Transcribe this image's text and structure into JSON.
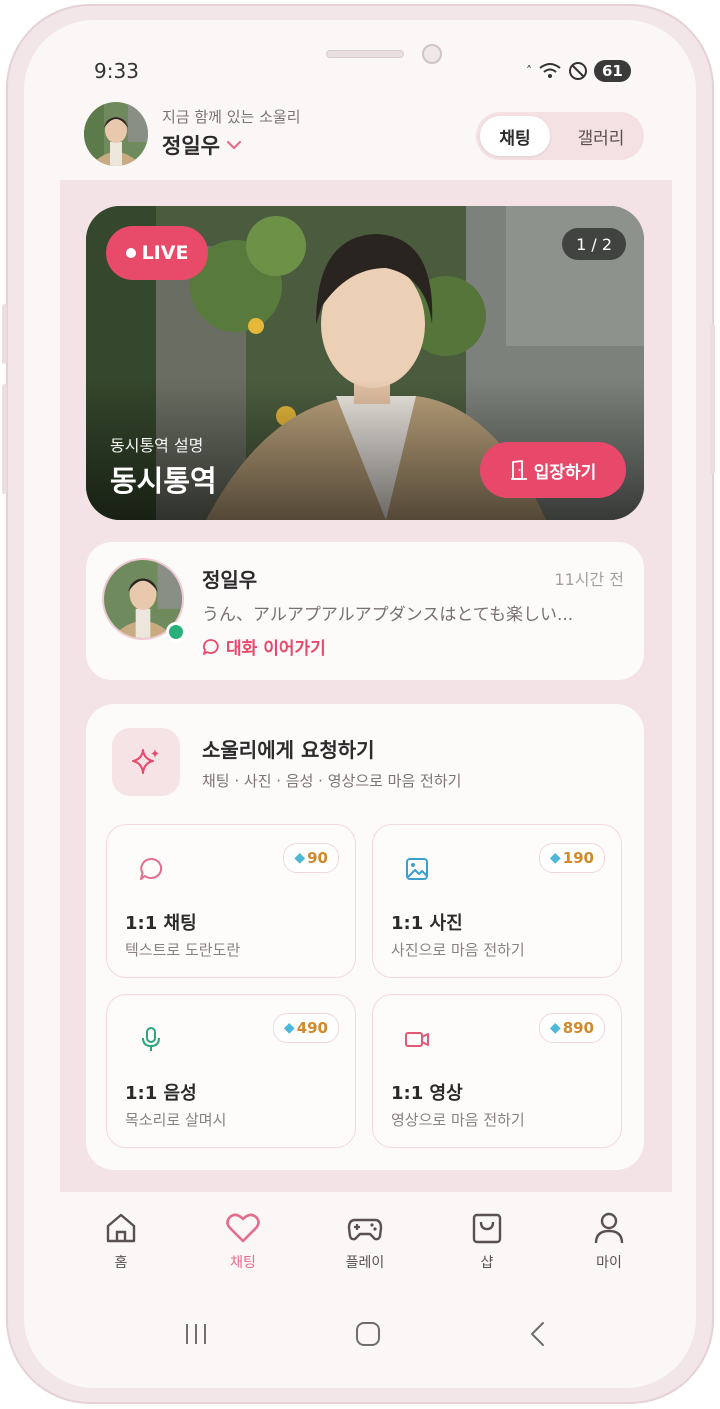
{
  "status_bar": {
    "time": "9:33",
    "battery": "61"
  },
  "header": {
    "subtitle": "지금 함께 있는 소울리",
    "name": "정일우",
    "toggle": {
      "active": "채팅",
      "inactive": "갤러리"
    }
  },
  "live": {
    "badge": "LIVE",
    "counter": "1 / 2",
    "desc": "동시통역 설명",
    "title": "동시통역",
    "enter_label": "입장하기"
  },
  "recent_chat": {
    "name": "정일우",
    "time": "11시간 전",
    "message": "うん、アルアプアルアプダンスはとても楽しい...",
    "cta": "대화 이어가기"
  },
  "request": {
    "title": "소울리에게 요청하기",
    "subtitle": "채팅 · 사진 · 음성 · 영상으로 마음 전하기",
    "items": [
      {
        "name": "1:1 채팅",
        "desc": "텍스트로 도란도란",
        "price": "90",
        "icon": "chat-bubble-icon"
      },
      {
        "name": "1:1 사진",
        "desc": "사진으로 마음 전하기",
        "price": "190",
        "icon": "image-icon"
      },
      {
        "name": "1:1 음성",
        "desc": "목소리로 살며시",
        "price": "490",
        "icon": "microphone-icon"
      },
      {
        "name": "1:1 영상",
        "desc": "영상으로 마음 전하기",
        "price": "890",
        "icon": "video-camera-icon"
      }
    ]
  },
  "tabs": [
    {
      "label": "홈",
      "icon": "home-icon"
    },
    {
      "label": "채팅",
      "icon": "heart-icon",
      "active": true
    },
    {
      "label": "플레이",
      "icon": "gamepad-icon"
    },
    {
      "label": "샵",
      "icon": "shopping-bag-icon"
    },
    {
      "label": "마이",
      "icon": "person-icon"
    }
  ],
  "colors": {
    "accent": "#e8496a",
    "accent_soft": "#e46c8c",
    "background": "#fbf7f6",
    "panel": "#f4e3e6",
    "online": "#28b07a",
    "price": "#d08a2c"
  }
}
